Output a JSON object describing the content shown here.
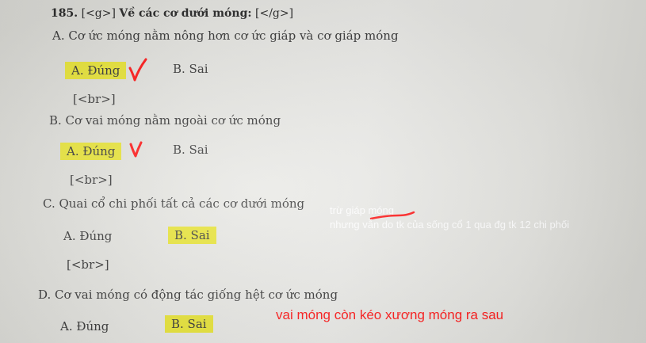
{
  "question": {
    "number": "185.",
    "tag_open": "[<g>]",
    "title": "Về các cơ dưới móng:",
    "tag_close": "[</g>]"
  },
  "items": [
    {
      "statement": "A. Cơ ức móng nằm nông hơn cơ ức giáp và cơ giáp móng",
      "option_a": "A. Đúng",
      "option_b": "B. Sai",
      "separator": "[<br>]"
    },
    {
      "statement": "B. Cơ vai móng nằm ngoài cơ ức móng",
      "option_a": "A. Đúng",
      "option_b": "B. Sai",
      "separator": "[<br>]"
    },
    {
      "statement": "C. Quai cổ chi phối tất cả các cơ dưới móng",
      "option_a": "A. Đúng",
      "option_b": "B. Sai",
      "separator": "[<br>]"
    },
    {
      "statement": "D. Cơ vai móng có động tác giống hệt cơ ức móng",
      "option_a": "A. Đúng",
      "option_b": "B. Sai"
    }
  ],
  "annotations": {
    "note_c_line1": "trừ giáp móng",
    "note_c_line2": "nhưng vẫn do tk của sống cổ 1 qua đg tk 12 chi phối",
    "note_d": "vai móng còn kéo xương móng ra sau"
  },
  "colors": {
    "highlight": "#e8e43a",
    "ink_red": "#ff1a1a",
    "note_white": "#ffffff",
    "paper": "#e6e6e2"
  }
}
